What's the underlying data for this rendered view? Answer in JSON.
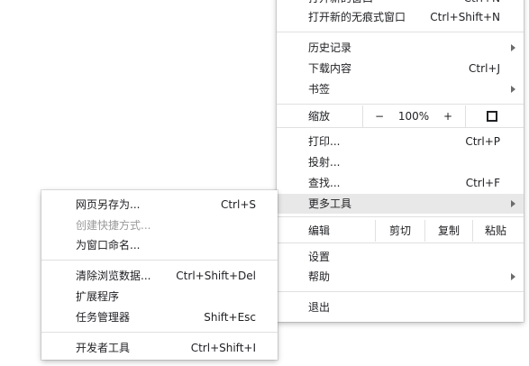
{
  "main_menu": {
    "open_new_window": {
      "label": "打开新的窗口",
      "shortcut": "Ctrl+N"
    },
    "open_incognito": {
      "label": "打开新的无痕式窗口",
      "shortcut": "Ctrl+Shift+N"
    },
    "history": {
      "label": "历史记录"
    },
    "downloads": {
      "label": "下载内容",
      "shortcut": "Ctrl+J"
    },
    "bookmarks": {
      "label": "书签"
    },
    "zoom": {
      "label": "缩放",
      "minus": "−",
      "value": "100%",
      "plus": "+"
    },
    "print": {
      "label": "打印...",
      "shortcut": "Ctrl+P"
    },
    "cast": {
      "label": "投射..."
    },
    "find": {
      "label": "查找...",
      "shortcut": "Ctrl+F"
    },
    "more_tools": {
      "label": "更多工具"
    },
    "edit": {
      "label": "编辑",
      "cut": "剪切",
      "copy": "复制",
      "paste": "粘贴"
    },
    "settings": {
      "label": "设置"
    },
    "help": {
      "label": "帮助"
    },
    "exit": {
      "label": "退出"
    }
  },
  "more_tools_menu": {
    "save_page_as": {
      "label": "网页另存为...",
      "shortcut": "Ctrl+S"
    },
    "create_shortcut": {
      "label": "创建快捷方式..."
    },
    "name_window": {
      "label": "为窗口命名..."
    },
    "clear_browsing_data": {
      "label": "清除浏览数据...",
      "shortcut": "Ctrl+Shift+Del"
    },
    "extensions": {
      "label": "扩展程序"
    },
    "task_manager": {
      "label": "任务管理器",
      "shortcut": "Shift+Esc"
    },
    "developer_tools": {
      "label": "开发者工具",
      "shortcut": "Ctrl+Shift+I"
    }
  },
  "colors": {
    "highlight": "#e8e8e8",
    "disabled_text": "#9a9a9a",
    "separator": "#e0e0e0"
  }
}
